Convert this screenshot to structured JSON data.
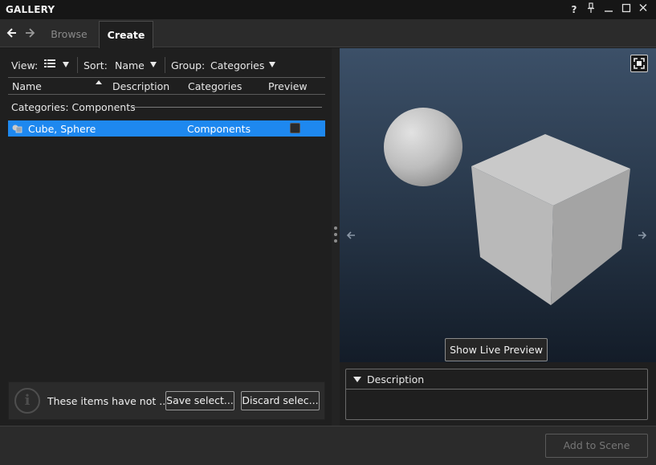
{
  "window": {
    "title": "GALLERY"
  },
  "titlebar_buttons": [
    "?",
    "pin-icon",
    "minimize-icon",
    "maximize-icon",
    "close-icon"
  ],
  "help_label": "?",
  "tabs": [
    {
      "label": "Browse",
      "active": false
    },
    {
      "label": "Create",
      "active": true
    }
  ],
  "toolbar": {
    "view_label": "View:",
    "view_icon": "list-view-icon",
    "sort_label": "Sort:",
    "sort_value": "Name",
    "group_label": "Group:",
    "group_value": "Categories"
  },
  "columns": [
    "Name",
    "Description",
    "Categories",
    "Preview"
  ],
  "group_heading": "Categories: Components",
  "items": [
    {
      "name": "Cube, Sphere",
      "description": "",
      "category": "Components",
      "preview": false,
      "selected": true,
      "icon": "shapes-icon"
    }
  ],
  "info": {
    "message": "These items have not ...",
    "save_label": "Save select...",
    "discard_label": "Discard selec..."
  },
  "preview": {
    "live_preview_label": "Show Live Preview",
    "description_label": "Description",
    "description_text": ""
  },
  "footer": {
    "add_label": "Add to Scene"
  },
  "colors": {
    "accent": "#1e88ef",
    "background": "#1f1f1f"
  }
}
